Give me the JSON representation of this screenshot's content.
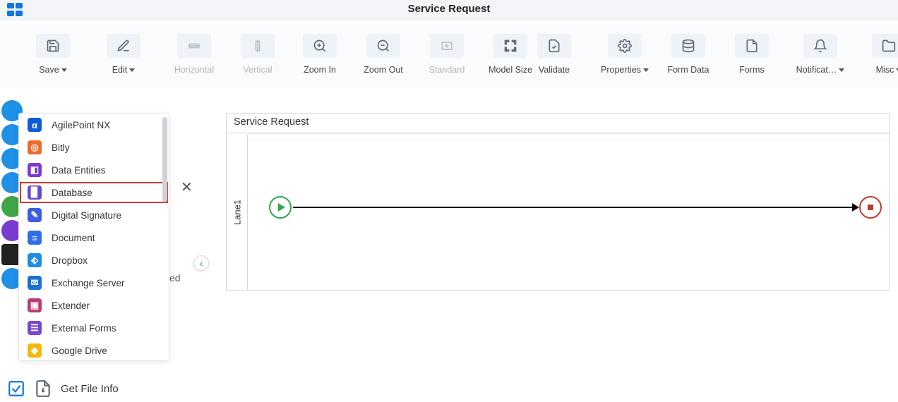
{
  "header": {
    "title": "Service Request"
  },
  "toolbar": {
    "save": "Save",
    "edit": "Edit",
    "horizontal": "Horizontal",
    "vertical": "Vertical",
    "zoomin": "Zoom In",
    "zoomout": "Zoom Out",
    "standard": "Standard",
    "modelsize": "Model Size",
    "validate": "Validate",
    "properties": "Properties",
    "formdata": "Form Data",
    "forms": "Forms",
    "notifications": "Notificat…",
    "misc": "Misc"
  },
  "activities": {
    "items": [
      {
        "label": "AgilePoint NX",
        "iconColor": "#0e5bd8",
        "glyph": "α"
      },
      {
        "label": "Bitly",
        "iconColor": "#ee6b2b",
        "glyph": "◎"
      },
      {
        "label": "Data Entities",
        "iconColor": "#7a3ccf",
        "glyph": "◧"
      },
      {
        "label": "Database",
        "iconColor": "#6948d3",
        "glyph": "▉",
        "highlight": true
      },
      {
        "label": "Digital Signature",
        "iconColor": "#3d5ee0",
        "glyph": "✎"
      },
      {
        "label": "Document",
        "iconColor": "#2f6fe6",
        "glyph": "≡"
      },
      {
        "label": "Dropbox",
        "iconColor": "#1f8de0",
        "glyph": "⬖"
      },
      {
        "label": "Exchange Server",
        "iconColor": "#1d6fd1",
        "glyph": "✉"
      },
      {
        "label": "Extender",
        "iconColor": "#b83d73",
        "glyph": "▣"
      },
      {
        "label": "External Forms",
        "iconColor": "#7a46d1",
        "glyph": "☰"
      },
      {
        "label": "Google Drive",
        "iconColor": "#f2b90f",
        "glyph": "◆"
      }
    ]
  },
  "misc": {
    "ed_text": "ed",
    "close": "✕",
    "chevron": "‹"
  },
  "getfileinfo": {
    "label": "Get File Info"
  },
  "canvas": {
    "title": "Service Request",
    "lane": "Lane1"
  }
}
